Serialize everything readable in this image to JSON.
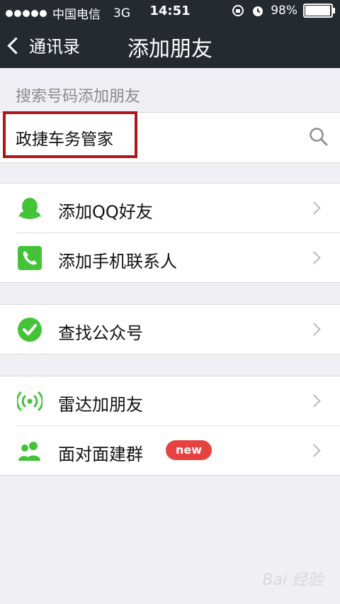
{
  "status": {
    "carrier": "中国电信",
    "network": "3G",
    "time": "14:51",
    "battery": "98%",
    "battery_level": 0.98
  },
  "nav": {
    "back_label": "通讯录",
    "title": "添加朋友"
  },
  "search": {
    "section_label": "搜索号码添加朋友",
    "value": "政捷车务管家"
  },
  "groups": [
    {
      "items": [
        {
          "label": "添加QQ好友",
          "icon": "qq-penguin-icon"
        },
        {
          "label": "添加手机联系人",
          "icon": "phone-contacts-icon"
        }
      ]
    },
    {
      "items": [
        {
          "label": "查找公众号",
          "icon": "official-account-check-icon"
        }
      ]
    },
    {
      "items": [
        {
          "label": "雷达加朋友",
          "icon": "radar-icon"
        },
        {
          "label": "面对面建群",
          "icon": "group-people-icon",
          "badge": "new"
        }
      ]
    }
  ],
  "watermark": "Bai 经验",
  "colors": {
    "header": "#252a30",
    "accent_green": "#44c339",
    "badge_red": "#e64340",
    "highlight_box": "#b0141c"
  }
}
